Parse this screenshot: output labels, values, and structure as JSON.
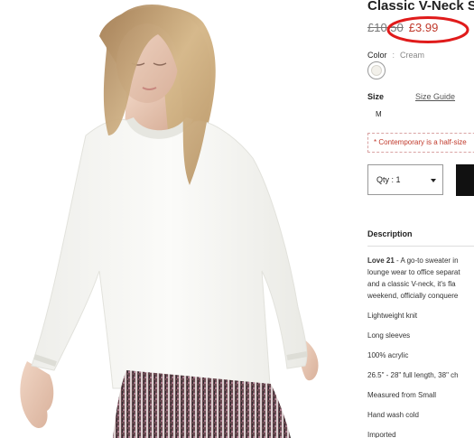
{
  "product": {
    "title": "Classic V-Neck S",
    "price_old": "£10.50",
    "price_new": "£3.99",
    "color_label": "Color",
    "color_separator": ":",
    "color_value": "Cream",
    "size_label": "Size",
    "size_guide_label": "Size Guide",
    "size_option": "M",
    "notice": "* Contemporary is a half-size",
    "quantity_label": "Qty : 1"
  },
  "description": {
    "title": "Description",
    "brand": "Love 21",
    "lines": [
      "- A go-to sweater in",
      "lounge wear to office separat",
      "and a classic V-neck, it's fla",
      "weekend, officially conquere"
    ]
  },
  "features": [
    "Lightweight knit",
    "Long sleeves",
    "100% acrylic",
    "26.5\" - 28\" full length, 38\" ch",
    "Measured from Small",
    "Hand wash cold",
    "Imported"
  ],
  "colors": {
    "sale_price": "#c0392b",
    "annotation_circle": "#e01b1b",
    "add_to_bag_button": "#111111",
    "sweater": "#f7f7f4"
  }
}
